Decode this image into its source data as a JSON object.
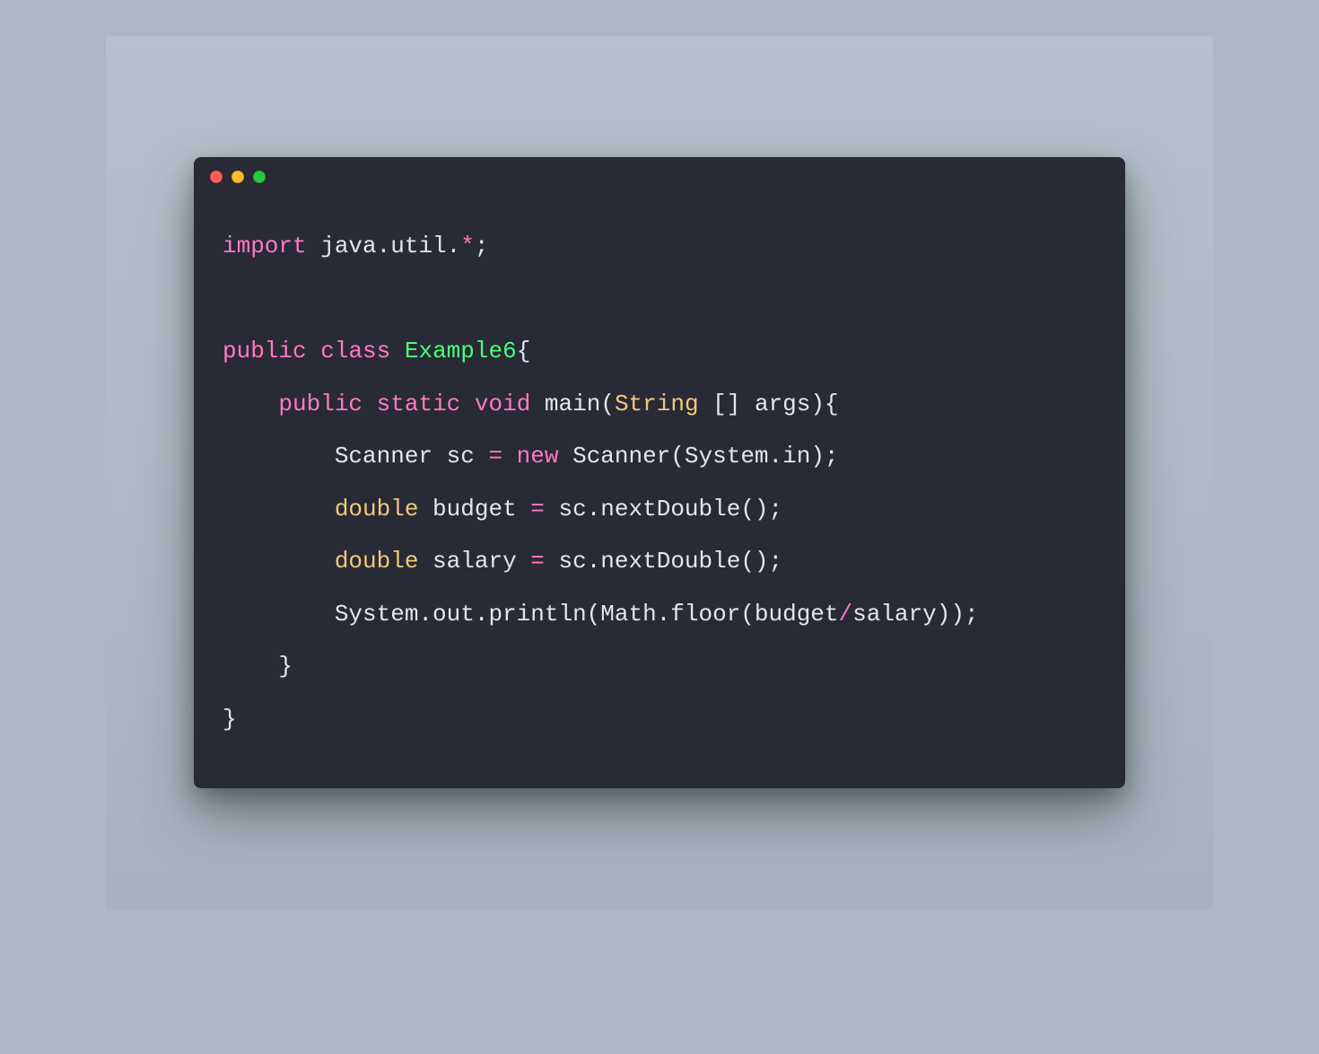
{
  "colors": {
    "background_outer": "#aeb8c4",
    "window_bg": "#282a36",
    "text": "#e4e6eb",
    "keyword": "#ff79c6",
    "classname": "#50fa7b",
    "type": "#f1c97b",
    "dot_red": "#ff5f56",
    "dot_yellow": "#ffbd2e",
    "dot_green": "#27c93f"
  },
  "language": "Java",
  "code_plain": "import java.util.*;\n\npublic class Example6{\n    public static void main(String [] args){\n        Scanner sc = new Scanner(System.in);\n        double budget = sc.nextDouble();\n        double salary = sc.nextDouble();\n        System.out.println(Math.floor(budget/salary));\n    }\n}",
  "code_lines": [
    [
      {
        "t": "import",
        "c": "kw"
      },
      {
        "t": " java.util.",
        "c": "fg"
      },
      {
        "t": "*",
        "c": "op"
      },
      {
        "t": ";",
        "c": "fg"
      }
    ],
    [],
    [
      {
        "t": "public",
        "c": "kw"
      },
      {
        "t": " ",
        "c": "fg"
      },
      {
        "t": "class",
        "c": "kw"
      },
      {
        "t": " ",
        "c": "fg"
      },
      {
        "t": "Example6",
        "c": "cls"
      },
      {
        "t": "{",
        "c": "fg"
      }
    ],
    [
      {
        "t": "    ",
        "c": "fg"
      },
      {
        "t": "public",
        "c": "kw"
      },
      {
        "t": " ",
        "c": "fg"
      },
      {
        "t": "static",
        "c": "kw"
      },
      {
        "t": " ",
        "c": "fg"
      },
      {
        "t": "void",
        "c": "kw"
      },
      {
        "t": " main(",
        "c": "fg"
      },
      {
        "t": "String",
        "c": "type"
      },
      {
        "t": " [] args){",
        "c": "fg"
      }
    ],
    [
      {
        "t": "        Scanner sc ",
        "c": "fg"
      },
      {
        "t": "=",
        "c": "op"
      },
      {
        "t": " ",
        "c": "fg"
      },
      {
        "t": "new",
        "c": "kw"
      },
      {
        "t": " Scanner(System.in);",
        "c": "fg"
      }
    ],
    [
      {
        "t": "        ",
        "c": "fg"
      },
      {
        "t": "double",
        "c": "type"
      },
      {
        "t": " budget ",
        "c": "fg"
      },
      {
        "t": "=",
        "c": "op"
      },
      {
        "t": " sc.nextDouble();",
        "c": "fg"
      }
    ],
    [
      {
        "t": "        ",
        "c": "fg"
      },
      {
        "t": "double",
        "c": "type"
      },
      {
        "t": " salary ",
        "c": "fg"
      },
      {
        "t": "=",
        "c": "op"
      },
      {
        "t": " sc.nextDouble();",
        "c": "fg"
      }
    ],
    [
      {
        "t": "        System.out.println(Math.floor(budget",
        "c": "fg"
      },
      {
        "t": "/",
        "c": "op"
      },
      {
        "t": "salary));",
        "c": "fg"
      }
    ],
    [
      {
        "t": "    }",
        "c": "fg"
      }
    ],
    [
      {
        "t": "}",
        "c": "fg"
      }
    ]
  ]
}
